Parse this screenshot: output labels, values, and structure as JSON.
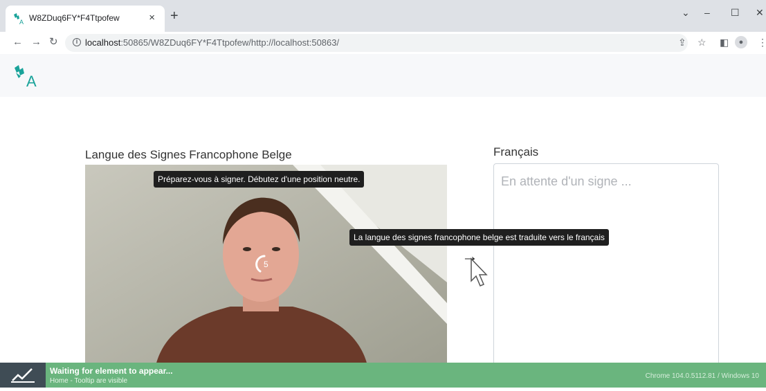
{
  "browser": {
    "tab_title": "W8ZDuq6FY*F4Ttpofew",
    "tab_close": "×",
    "new_tab": "+",
    "url_host": "localhost",
    "url_path": ":50865/W8ZDuq6FY*F4Ttpofew/http://localhost:50863/",
    "window_controls": {
      "dropdown": "⌄",
      "minimize": "–",
      "maximize": "☐",
      "close": "✕"
    }
  },
  "app": {
    "sign_heading": "Langue des Signes Francophone Belge",
    "french_heading": "Français",
    "output_placeholder": "En attente d'un signe ...",
    "camera_tooltip": "Préparez-vous à signer. Débutez d'une position neutre.",
    "countdown": "5",
    "arrow_tooltip": "La langue des signes francophone belge est traduite vers le français",
    "arrow_glyph": "→",
    "brand_color": "#1aa39a"
  },
  "status_bar": {
    "title": "Waiting for element to appear...",
    "subtitle": "Home - Tooltip are visible",
    "environment": "Chrome 104.0.5112.81 / Windows 10",
    "color": "#6ab57e"
  }
}
